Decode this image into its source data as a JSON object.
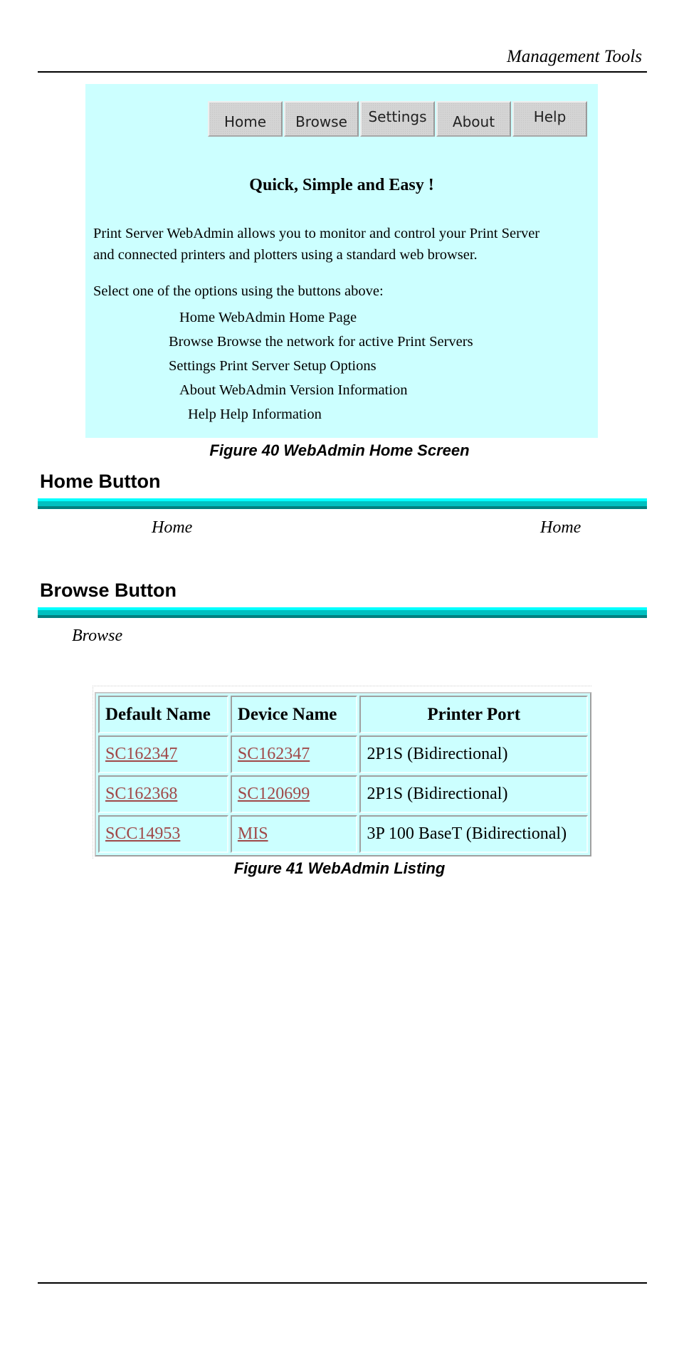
{
  "page": {
    "running_head": "Management Tools"
  },
  "figure40": {
    "nav_buttons": [
      {
        "label": "Home"
      },
      {
        "label": "Browse"
      },
      {
        "label": "Settings"
      },
      {
        "label": "About"
      },
      {
        "label": "Help"
      }
    ],
    "title": "Quick, Simple and Easy !",
    "paragraph_lines": [
      "Print Server WebAdmin allows you to monitor and control your Print Server",
      "and connected printers and plotters using a standard web browser."
    ],
    "select_prompt": "Select one of the options using the buttons above:",
    "options": [
      {
        "name": "Home",
        "description": "WebAdmin Home Page"
      },
      {
        "name": "Browse",
        "description": "Browse the network for active Print Servers"
      },
      {
        "name": "Settings",
        "description": "Print Server Setup Options"
      },
      {
        "name": "About",
        "description": "WebAdmin Version Information"
      },
      {
        "name": "Help",
        "description": "Help Information"
      }
    ],
    "caption": "Figure 40 WebAdmin Home Screen"
  },
  "home_section": {
    "heading": "Home Button",
    "word_left": "Home",
    "word_right": "Home"
  },
  "browse_section": {
    "heading": "Browse Button",
    "word": "Browse"
  },
  "figure41": {
    "columns": [
      "Default Name",
      "Device Name",
      "Printer Port"
    ],
    "rows": [
      {
        "default_name": "SC162347",
        "device_name": "SC162347",
        "printer_port": "2P1S (Bidirectional)"
      },
      {
        "default_name": "SC162368",
        "device_name": "SC120699",
        "printer_port": "2P1S (Bidirectional)"
      },
      {
        "default_name": "SCC14953",
        "device_name": "MIS",
        "printer_port": "3P 100 BaseT (Bidirectional)"
      }
    ],
    "caption": "Figure 41 WebAdmin Listing"
  },
  "colors": {
    "webadmin_background": "#ccffff",
    "link": "#a04848",
    "rule_cyan": "#00ffff",
    "rule_mid_teal": "#00c0c0",
    "rule_dark_teal": "#008080"
  }
}
